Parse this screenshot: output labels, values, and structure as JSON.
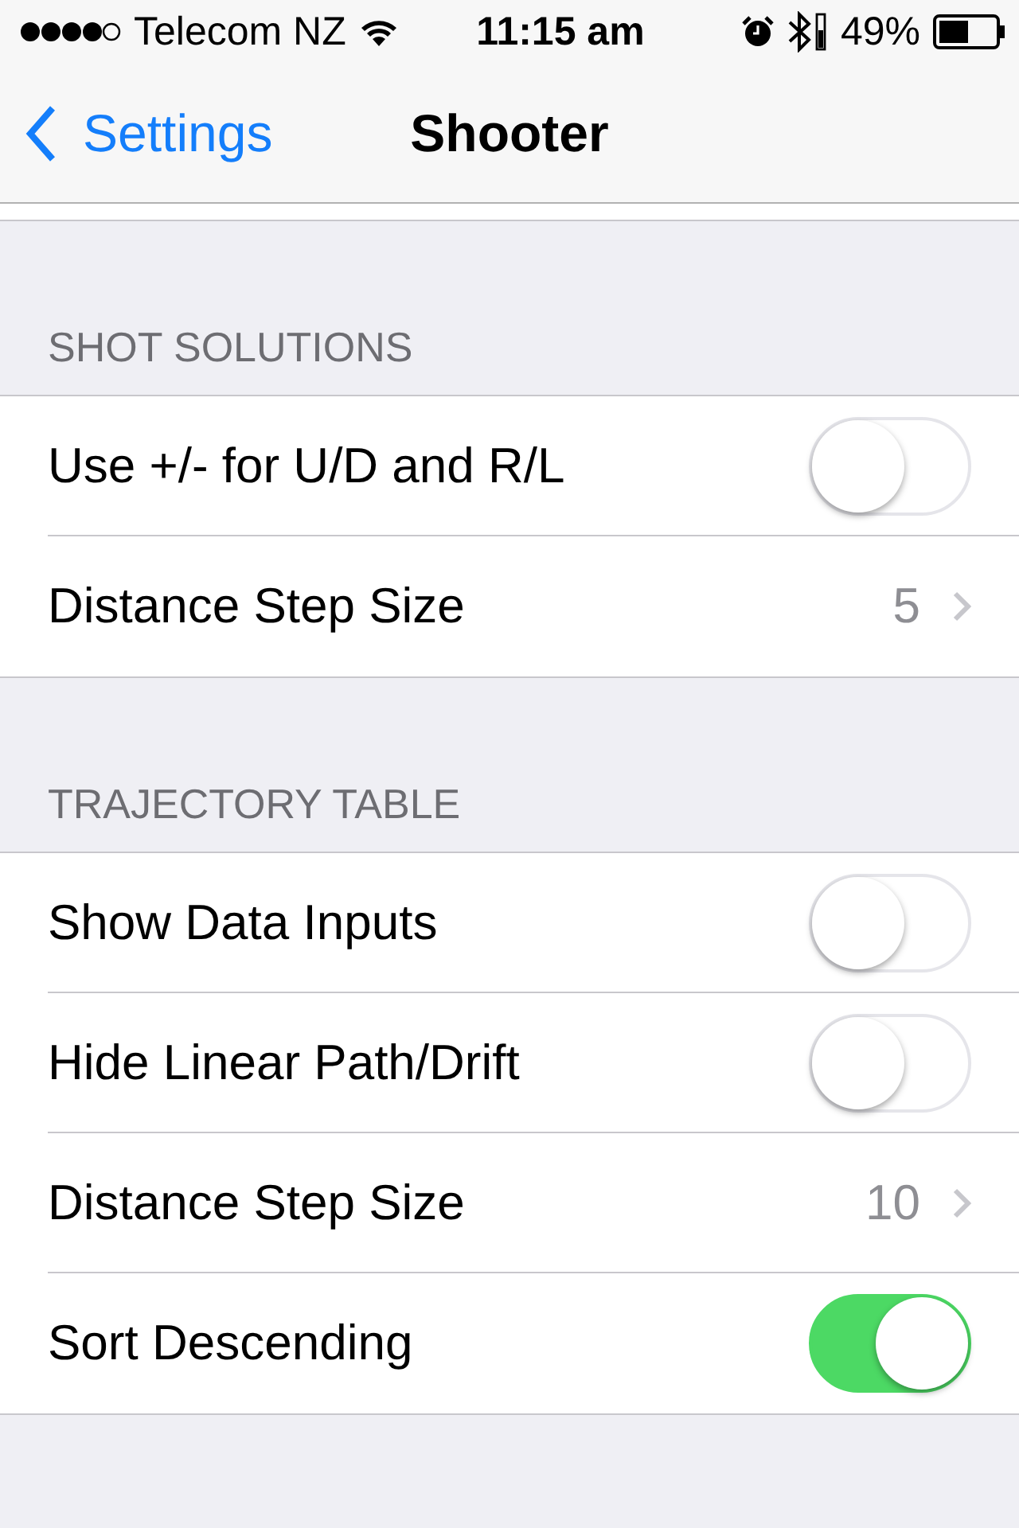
{
  "status_bar": {
    "carrier": "Telecom NZ",
    "time": "11:15 am",
    "battery": "49%"
  },
  "nav": {
    "back": "Settings",
    "title": "Shooter"
  },
  "sections": [
    {
      "header": "SHOT SOLUTIONS",
      "rows": [
        {
          "kind": "toggle",
          "label": "Use +/- for U/D and R/L",
          "on": false
        },
        {
          "kind": "value",
          "label": "Distance Step Size",
          "value": "5"
        }
      ]
    },
    {
      "header": "TRAJECTORY TABLE",
      "rows": [
        {
          "kind": "toggle",
          "label": "Show Data Inputs",
          "on": false
        },
        {
          "kind": "toggle",
          "label": "Hide Linear Path/Drift",
          "on": false
        },
        {
          "kind": "value",
          "label": "Distance Step Size",
          "value": "10"
        },
        {
          "kind": "toggle",
          "label": "Sort Descending",
          "on": true
        }
      ]
    }
  ]
}
